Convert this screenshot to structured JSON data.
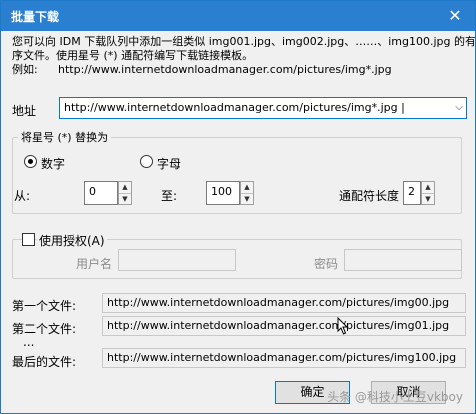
{
  "window": {
    "title": "批量下载"
  },
  "description": {
    "line1": "您可以向 IDM 下载队列中添加一组类似 img001.jpg、img002.jpg、……、img100.jpg 的有",
    "line2": "序文件。使用星号 (*) 通配符编写下载链接模板。",
    "example_label": "例如:",
    "example_value": "http://www.internetdownloadmanager.com/pictures/img*.jpg"
  },
  "address": {
    "label": "地址",
    "value": "http://www.internetdownloadmanager.com/pictures/img*.jpg"
  },
  "replace_group": {
    "title": "将星号 (*) 替换为",
    "options": {
      "number": "数字",
      "letter": "字母"
    },
    "selected": "number",
    "from_label": "从:",
    "from_value": "0",
    "to_label": "至:",
    "to_value": "100",
    "wildcard_length_label": "通配符长度",
    "wildcard_length_value": "2"
  },
  "auth_group": {
    "title": "使用授权(A)",
    "checked": false,
    "username_label": "用户名",
    "password_label": "密码"
  },
  "files": {
    "first_label": "第一个文件:",
    "first_value": "http://www.internetdownloadmanager.com/pictures/img00.jpg",
    "second_label": "第二个文件:",
    "second_value": "http://www.internetdownloadmanager.com/pictures/img01.jpg",
    "ellipsis": "...",
    "last_label": "最后的文件:",
    "last_value": "http://www.internetdownloadmanager.com/pictures/img100.jpg"
  },
  "buttons": {
    "ok": "确定",
    "cancel": "取消"
  },
  "watermark": "头条 @科技小土豆vkboy"
}
